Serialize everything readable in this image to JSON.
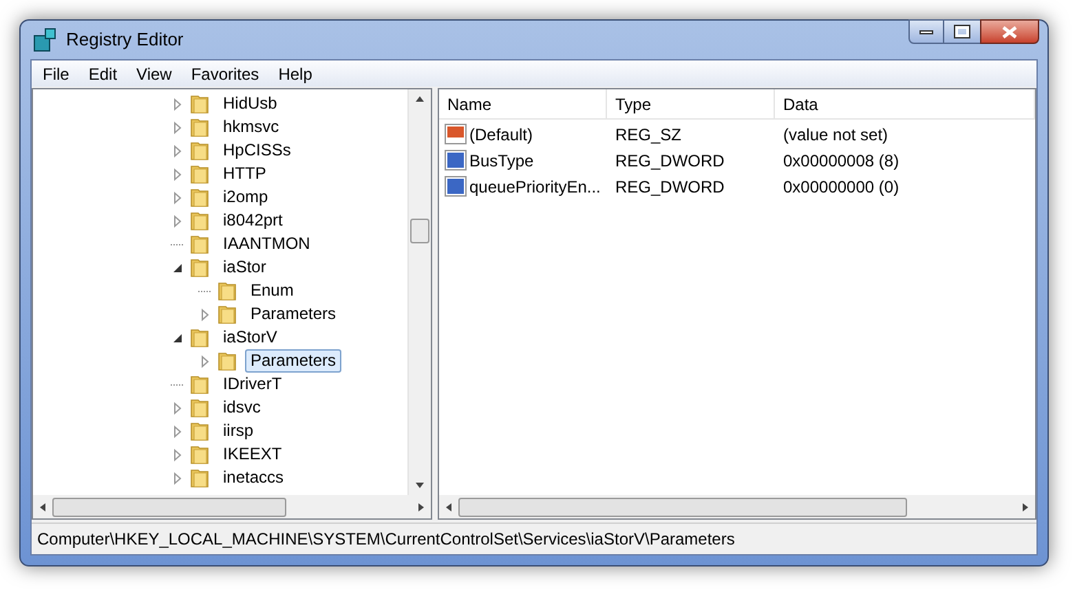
{
  "window": {
    "title": "Registry Editor"
  },
  "menu": [
    "File",
    "Edit",
    "View",
    "Favorites",
    "Help"
  ],
  "tree": [
    {
      "label": "HidUsb",
      "has_children": true,
      "expanded": false,
      "selected": false
    },
    {
      "label": "hkmsvc",
      "has_children": true,
      "expanded": false,
      "selected": false
    },
    {
      "label": "HpCISSs",
      "has_children": true,
      "expanded": false,
      "selected": false
    },
    {
      "label": "HTTP",
      "has_children": true,
      "expanded": false,
      "selected": false
    },
    {
      "label": "i2omp",
      "has_children": true,
      "expanded": false,
      "selected": false
    },
    {
      "label": "i8042prt",
      "has_children": true,
      "expanded": false,
      "selected": false
    },
    {
      "label": "IAANTMON",
      "has_children": false,
      "selected": false
    },
    {
      "label": "iaStor",
      "has_children": true,
      "expanded": true,
      "selected": false,
      "children": [
        {
          "label": "Enum",
          "has_children": false,
          "selected": false
        },
        {
          "label": "Parameters",
          "has_children": true,
          "expanded": false,
          "selected": false
        }
      ]
    },
    {
      "label": "iaStorV",
      "has_children": true,
      "expanded": true,
      "selected": false,
      "children": [
        {
          "label": "Parameters",
          "has_children": true,
          "expanded": false,
          "selected": true
        }
      ]
    },
    {
      "label": "IDriverT",
      "has_children": false,
      "selected": false
    },
    {
      "label": "idsvc",
      "has_children": true,
      "expanded": false,
      "selected": false
    },
    {
      "label": "iirsp",
      "has_children": true,
      "expanded": false,
      "selected": false
    },
    {
      "label": "IKEEXT",
      "has_children": true,
      "expanded": false,
      "selected": false
    },
    {
      "label": "inetaccs",
      "has_children": true,
      "expanded": false,
      "selected": false
    }
  ],
  "values": {
    "columns": [
      "Name",
      "Type",
      "Data"
    ],
    "rows": [
      {
        "kind": "string",
        "name": "(Default)",
        "type": "REG_SZ",
        "data": "(value not set)"
      },
      {
        "kind": "binary",
        "name": "BusType",
        "type": "REG_DWORD",
        "data": "0x00000008 (8)"
      },
      {
        "kind": "binary",
        "name": "queuePriorityEn...",
        "type": "REG_DWORD",
        "data": "0x00000000 (0)"
      }
    ]
  },
  "status_bar": "Computer\\HKEY_LOCAL_MACHINE\\SYSTEM\\CurrentControlSet\\Services\\iaStorV\\Parameters"
}
